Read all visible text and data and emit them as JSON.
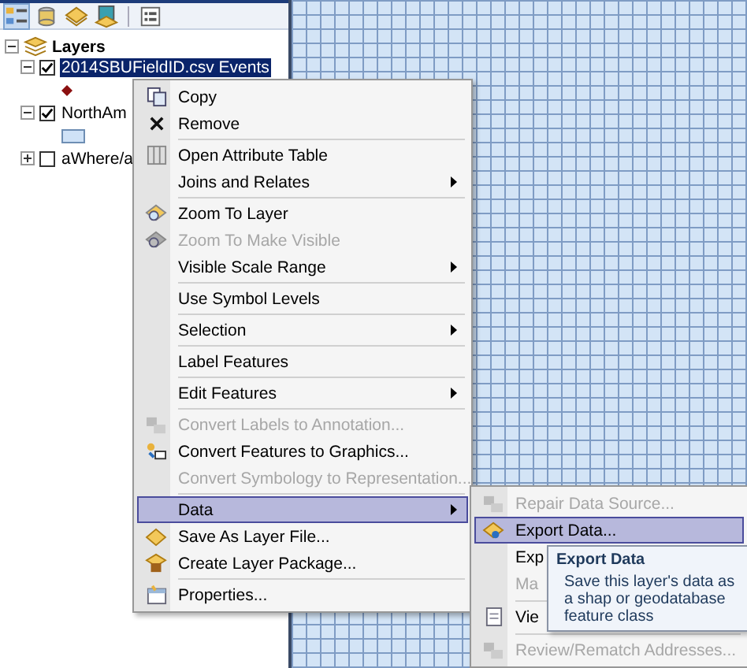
{
  "toc": {
    "root": {
      "label": "Layers",
      "expanded": true,
      "children": [
        {
          "label": "2014SBUFieldID.csv Events",
          "checked": true,
          "selected": true,
          "expanded": true,
          "kind": "point"
        },
        {
          "label": "NorthAm",
          "checked": true,
          "selected": false,
          "expanded": true,
          "kind": "polygon"
        },
        {
          "label": "aWhere/a",
          "checked": false,
          "selected": false,
          "expanded": false
        }
      ]
    }
  },
  "context_menu": {
    "items": [
      {
        "kind": "copy",
        "label": "Copy",
        "disabled": false,
        "submenu": false,
        "selected": false
      },
      {
        "kind": "remove",
        "label": "Remove",
        "disabled": false,
        "submenu": false,
        "selected": false
      },
      {
        "kind": "separator"
      },
      {
        "kind": "table",
        "label": "Open Attribute Table",
        "disabled": false,
        "submenu": false,
        "selected": false
      },
      {
        "kind": "plain",
        "label": "Joins and Relates",
        "disabled": false,
        "submenu": true,
        "selected": false
      },
      {
        "kind": "separator"
      },
      {
        "kind": "zoom",
        "label": "Zoom To Layer",
        "disabled": false,
        "submenu": false,
        "selected": false
      },
      {
        "kind": "zoom",
        "label": "Zoom To Make Visible",
        "disabled": true,
        "submenu": false,
        "selected": false
      },
      {
        "kind": "plain",
        "label": "Visible Scale Range",
        "disabled": false,
        "submenu": true,
        "selected": false
      },
      {
        "kind": "separator"
      },
      {
        "kind": "plain",
        "label": "Use Symbol Levels",
        "disabled": false,
        "submenu": false,
        "selected": false
      },
      {
        "kind": "separator"
      },
      {
        "kind": "plain",
        "label": "Selection",
        "disabled": false,
        "submenu": true,
        "selected": false
      },
      {
        "kind": "separator"
      },
      {
        "kind": "plain",
        "label": "Label Features",
        "disabled": false,
        "submenu": false,
        "selected": false
      },
      {
        "kind": "separator"
      },
      {
        "kind": "plain",
        "label": "Edit Features",
        "disabled": false,
        "submenu": true,
        "selected": false
      },
      {
        "kind": "separator"
      },
      {
        "kind": "shapes",
        "label": "Convert Labels to Annotation...",
        "disabled": true,
        "submenu": false,
        "selected": false
      },
      {
        "kind": "graphics",
        "label": "Convert Features to Graphics...",
        "disabled": false,
        "submenu": false,
        "selected": false
      },
      {
        "kind": "plain",
        "label": "Convert Symbology to Representation...",
        "disabled": true,
        "submenu": false,
        "selected": false
      },
      {
        "kind": "separator"
      },
      {
        "kind": "plain",
        "label": "Data",
        "disabled": false,
        "submenu": true,
        "selected": true
      },
      {
        "kind": "diamond",
        "label": "Save As Layer File...",
        "disabled": false,
        "submenu": false,
        "selected": false
      },
      {
        "kind": "package",
        "label": "Create Layer Package...",
        "disabled": false,
        "submenu": false,
        "selected": false
      },
      {
        "kind": "separator"
      },
      {
        "kind": "properties",
        "label": "Properties...",
        "disabled": false,
        "submenu": false,
        "selected": false
      }
    ]
  },
  "data_submenu": {
    "items": [
      {
        "kind": "shapes",
        "label": "Repair Data Source...",
        "disabled": true,
        "selected": false
      },
      {
        "kind": "export",
        "label": "Export Data...",
        "disabled": false,
        "selected": true
      },
      {
        "kind": "plain",
        "label": "Exp",
        "disabled": false,
        "selected": false
      },
      {
        "kind": "plain",
        "label": "Ma",
        "disabled": true,
        "selected": false
      },
      {
        "kind": "separator"
      },
      {
        "kind": "document",
        "label": "Vie",
        "disabled": false,
        "selected": false
      },
      {
        "kind": "separator"
      },
      {
        "kind": "shapes",
        "label": "Review/Rematch Addresses...",
        "disabled": true,
        "selected": false
      }
    ]
  },
  "tooltip": {
    "title": "Export Data",
    "text": "Save this layer's data as a shap or geodatabase feature class"
  }
}
